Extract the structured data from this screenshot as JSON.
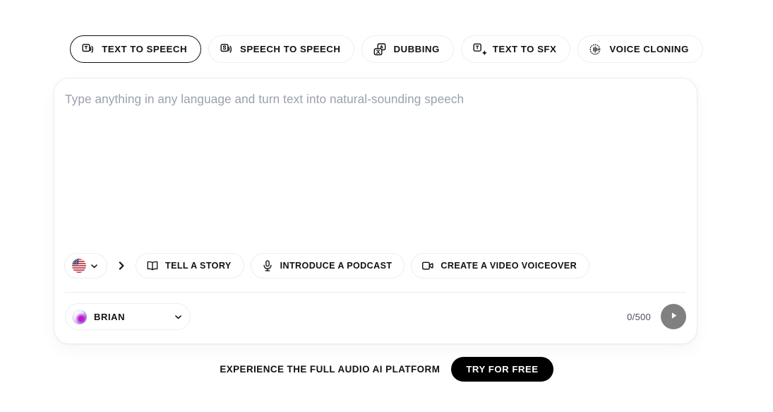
{
  "tabs": [
    {
      "label": "TEXT TO SPEECH",
      "icon": "text-to-speech-icon",
      "active": true
    },
    {
      "label": "SPEECH TO SPEECH",
      "icon": "speech-to-speech-icon",
      "active": false
    },
    {
      "label": "DUBBING",
      "icon": "dubbing-translate-icon",
      "active": false
    },
    {
      "label": "TEXT TO SFX",
      "icon": "text-to-sfx-icon",
      "active": false
    },
    {
      "label": "VOICE CLONING",
      "icon": "voice-cloning-icon",
      "active": false
    }
  ],
  "editor": {
    "placeholder": "Type anything in any language and turn text into natural-sounding speech"
  },
  "language": {
    "flag": "us-flag-icon",
    "chevron": "chevron-down-icon"
  },
  "separator_icon": "chevron-right-icon",
  "chips": [
    {
      "label": "TELL A STORY",
      "icon": "book-icon"
    },
    {
      "label": "INTRODUCE A PODCAST",
      "icon": "microphone-icon"
    },
    {
      "label": "CREATE A VIDEO VOICEOVER",
      "icon": "video-camera-icon"
    }
  ],
  "voice": {
    "name": "BRIAN",
    "avatar": "voice-avatar",
    "chevron": "chevron-down-icon"
  },
  "counter": "0/500",
  "play": {
    "icon": "play-icon",
    "color": "#808080"
  },
  "footer": {
    "text": "EXPERIENCE THE FULL AUDIO AI PLATFORM",
    "cta_label": "TRY FOR FREE",
    "cta_color": "#000000"
  },
  "colors": {
    "text": "#111115",
    "placeholder": "#9aa0ae",
    "border": "#eceef1",
    "active_border": "#111115"
  }
}
